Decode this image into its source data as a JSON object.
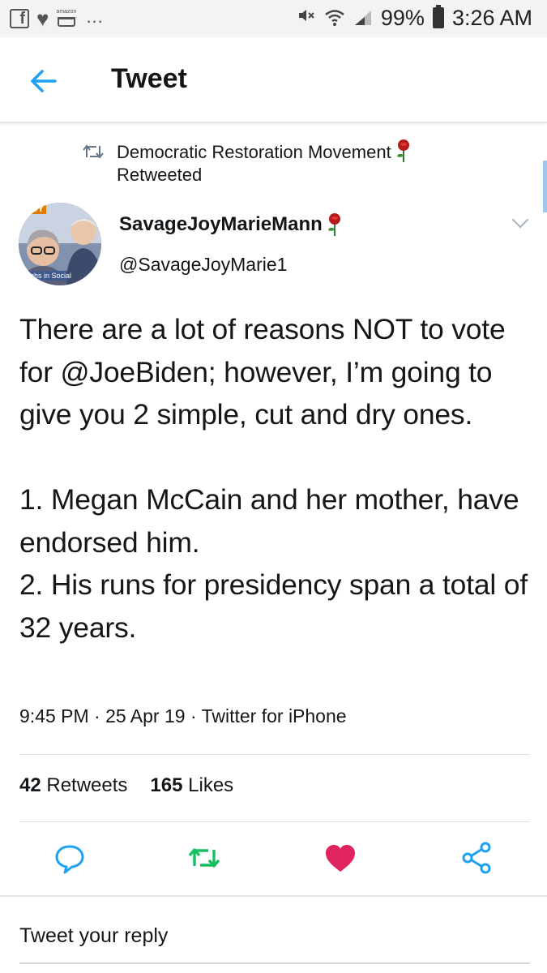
{
  "status_bar": {
    "left_icons": [
      "facebook-icon",
      "heart-icon",
      "amazon-cart-icon",
      "more-dots-icon"
    ],
    "amazon_text": "amazon",
    "dots": "...",
    "battery_percent": "99%",
    "time": "3:26 AM"
  },
  "header": {
    "title": "Tweet",
    "accent_color": "#1da1f2"
  },
  "retweet_context": {
    "icon": "retweet-icon",
    "account": "Democratic Restoration Movement",
    "suffix": "Retweeted"
  },
  "author": {
    "display_name": "SavageJoyMarieMann",
    "handle": "@SavageJoyMarie1",
    "avatar_text_top": "JOY",
    "avatar_text_bottom": "aughs in Social"
  },
  "tweet": {
    "text": "There are a lot of reasons NOT to vote for @JoeBiden; however, I’m going to give you 2 simple, cut and dry ones.\n\n1. Megan McCain and her mother, have endorsed him.\n2. His runs for presidency span a total of 32 years.",
    "meta": "9:45 PM · 25 Apr 19 · Twitter for iPhone"
  },
  "stats": {
    "retweets_count": "42",
    "retweets_label": "Retweets",
    "likes_count": "165",
    "likes_label": "Likes"
  },
  "actions": {
    "reply_icon": "reply-icon",
    "retweet_icon": "retweet-icon",
    "like_icon": "heart-icon",
    "share_icon": "share-icon",
    "retweet_color": "#17bf63",
    "like_color": "#e0245e"
  },
  "reply": {
    "placeholder": "Tweet your reply"
  }
}
